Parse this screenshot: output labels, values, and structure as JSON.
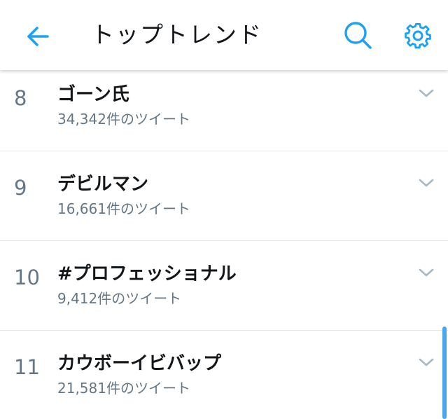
{
  "header": {
    "title": "トップトレンド",
    "back_icon": "arrow-left-icon",
    "search_icon": "search-icon",
    "settings_icon": "gear-icon"
  },
  "trends": [
    {
      "rank": "8",
      "name": "ゴーン氏",
      "count": "34,342件のツイート"
    },
    {
      "rank": "9",
      "name": "デビルマン",
      "count": "16,661件のツイート"
    },
    {
      "rank": "10",
      "name": "#プロフェッショナル",
      "count": "9,412件のツイート"
    },
    {
      "rank": "11",
      "name": "カウボーイビバップ",
      "count": "21,581件のツイート"
    }
  ],
  "colors": {
    "accent": "#1da1f2",
    "text_primary": "#14171a",
    "text_secondary": "#657786",
    "divider": "#e1e8ed",
    "scrollbar": "#4aa6ef"
  }
}
